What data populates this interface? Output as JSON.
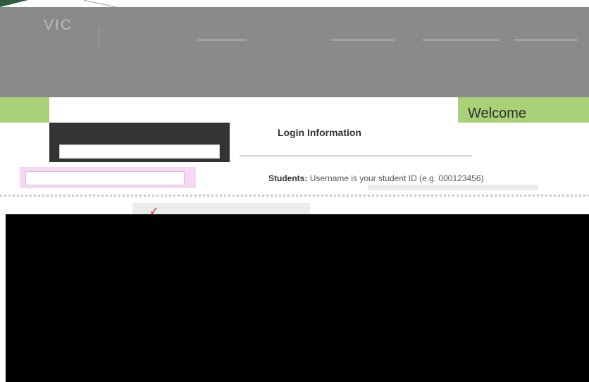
{
  "header": {
    "logo": "VIC",
    "logo_sub1": "",
    "logo_sub2": "",
    "tagline": ""
  },
  "welcome": "Welcome",
  "login": {
    "username_label": "",
    "username_value": "",
    "password_value": ""
  },
  "info": {
    "title": "Login Information",
    "students_label": "Students:",
    "students_text": "Username is your student ID (e.g. 000123456)",
    "help_text": ""
  },
  "colors": {
    "header_gray": "#8a8a8a",
    "accent_green": "#a9d178",
    "panel_dark": "#333333",
    "panel_pink": "#f6d8f4"
  }
}
